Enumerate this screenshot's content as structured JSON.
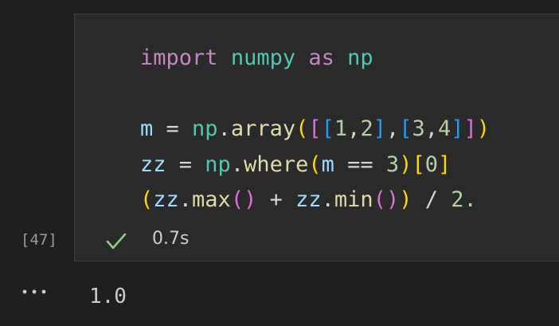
{
  "cell": {
    "execution_count": "[47]",
    "status_icon": "check-icon",
    "duration": "0.7s",
    "lines": [
      [
        {
          "text": "import",
          "color": "#c586c0"
        },
        {
          "text": " ",
          "color": "#d4d4d4"
        },
        {
          "text": "numpy",
          "color": "#4ec9b0"
        },
        {
          "text": " ",
          "color": "#d4d4d4"
        },
        {
          "text": "as",
          "color": "#c586c0"
        },
        {
          "text": " ",
          "color": "#d4d4d4"
        },
        {
          "text": "np",
          "color": "#4ec9b0"
        }
      ],
      [],
      [
        {
          "text": "m",
          "color": "#9cdcfe"
        },
        {
          "text": " = ",
          "color": "#d4d4d4"
        },
        {
          "text": "np",
          "color": "#4ec9b0"
        },
        {
          "text": ".",
          "color": "#d4d4d4"
        },
        {
          "text": "array",
          "color": "#dcdcaa"
        },
        {
          "text": "(",
          "color": "#ffd700"
        },
        {
          "text": "[",
          "color": "#da70d6"
        },
        {
          "text": "[",
          "color": "#179fff"
        },
        {
          "text": "1",
          "color": "#b5cea8"
        },
        {
          "text": ",",
          "color": "#d4d4d4"
        },
        {
          "text": "2",
          "color": "#b5cea8"
        },
        {
          "text": "]",
          "color": "#179fff"
        },
        {
          "text": ",",
          "color": "#d4d4d4"
        },
        {
          "text": "[",
          "color": "#179fff"
        },
        {
          "text": "3",
          "color": "#b5cea8"
        },
        {
          "text": ",",
          "color": "#d4d4d4"
        },
        {
          "text": "4",
          "color": "#b5cea8"
        },
        {
          "text": "]",
          "color": "#179fff"
        },
        {
          "text": "]",
          "color": "#da70d6"
        },
        {
          "text": ")",
          "color": "#ffd700"
        }
      ],
      [
        {
          "text": "zz",
          "color": "#9cdcfe"
        },
        {
          "text": " = ",
          "color": "#d4d4d4"
        },
        {
          "text": "np",
          "color": "#4ec9b0"
        },
        {
          "text": ".",
          "color": "#d4d4d4"
        },
        {
          "text": "where",
          "color": "#dcdcaa"
        },
        {
          "text": "(",
          "color": "#ffd700"
        },
        {
          "text": "m",
          "color": "#9cdcfe"
        },
        {
          "text": " == ",
          "color": "#d4d4d4"
        },
        {
          "text": "3",
          "color": "#b5cea8"
        },
        {
          "text": ")",
          "color": "#ffd700"
        },
        {
          "text": "[",
          "color": "#ffd700"
        },
        {
          "text": "0",
          "color": "#b5cea8"
        },
        {
          "text": "]",
          "color": "#ffd700"
        }
      ],
      [
        {
          "text": "(",
          "color": "#ffd700"
        },
        {
          "text": "zz",
          "color": "#9cdcfe"
        },
        {
          "text": ".",
          "color": "#d4d4d4"
        },
        {
          "text": "max",
          "color": "#dcdcaa"
        },
        {
          "text": "()",
          "color": "#da70d6"
        },
        {
          "text": " + ",
          "color": "#d4d4d4"
        },
        {
          "text": "zz",
          "color": "#9cdcfe"
        },
        {
          "text": ".",
          "color": "#d4d4d4"
        },
        {
          "text": "min",
          "color": "#dcdcaa"
        },
        {
          "text": "()",
          "color": "#da70d6"
        },
        {
          "text": ")",
          "color": "#ffd700"
        },
        {
          "text": " / ",
          "color": "#d4d4d4"
        },
        {
          "text": "2.",
          "color": "#b5cea8"
        }
      ]
    ]
  },
  "output": {
    "ellipsis_icon": "ellipsis-icon",
    "text": "1.0"
  },
  "colors": {
    "background": "#1f1f1f",
    "cell_background": "#2a2a2a",
    "success": "#89d185"
  }
}
